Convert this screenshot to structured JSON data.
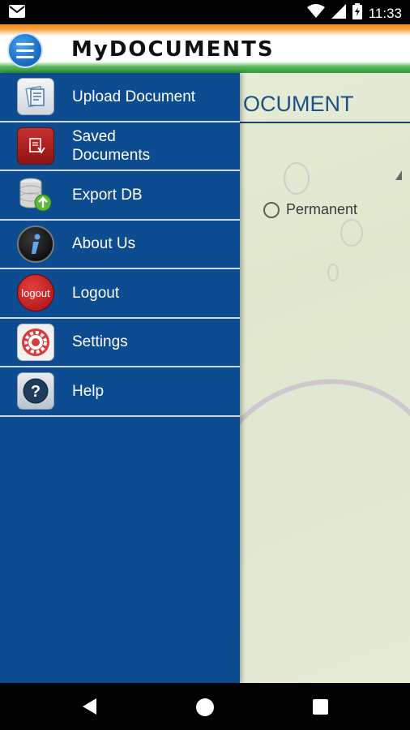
{
  "status_bar": {
    "time": "11:33",
    "icons": [
      "gmail-icon",
      "wifi-icon",
      "signal-icon",
      "battery-icon"
    ]
  },
  "header": {
    "title": "MyDOCUMENTS",
    "menu_icon": "hamburger-icon"
  },
  "content": {
    "page_title": "UPLOAD DOCUMENT",
    "visible_title_fragment": "OCUMENT",
    "radio_label": "Permanent"
  },
  "drawer": {
    "items": [
      {
        "label": "Upload Document",
        "icon": "upload-document-icon"
      },
      {
        "label": "Saved\nDocuments",
        "icon": "saved-documents-icon"
      },
      {
        "label": "Export DB",
        "icon": "export-db-icon"
      },
      {
        "label": "About Us",
        "icon": "about-info-icon"
      },
      {
        "label": "Logout",
        "icon": "logout-icon",
        "icon_text": "logout"
      },
      {
        "label": "Settings",
        "icon": "settings-gear-icon"
      },
      {
        "label": "Help",
        "icon": "help-question-icon"
      }
    ]
  },
  "nav_bar": {
    "icons": [
      "back-icon",
      "home-icon",
      "recents-icon"
    ]
  },
  "colors": {
    "drawer": "#0e4c92",
    "divider": "#cfd9e6",
    "accent_orange": "#f08a1a",
    "accent_green": "#2e9a3a"
  }
}
